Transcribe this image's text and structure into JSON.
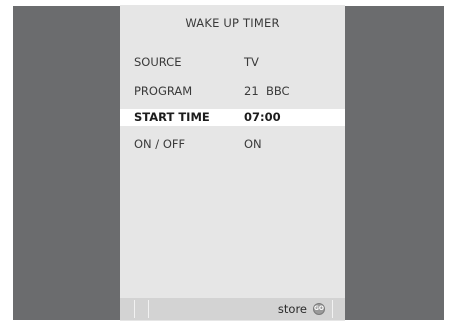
{
  "menu": {
    "title": "WAKE UP TIMER",
    "rows": [
      {
        "label": "SOURCE",
        "value": "TV"
      },
      {
        "label": "PROGRAM",
        "value": "21  BBC"
      },
      {
        "label": "START  TIME",
        "value": "07:00",
        "selected": true
      },
      {
        "label": "ON / OFF",
        "value": "ON"
      }
    ]
  },
  "footer": {
    "store_label": "store",
    "go_button": "GO",
    "go_icon": "go-button-icon"
  },
  "colors": {
    "backdrop": "#6b6c6e",
    "panel": "#e6e6e6",
    "selected_row": "#ffffff",
    "footer_bar": "#d3d3d3"
  }
}
